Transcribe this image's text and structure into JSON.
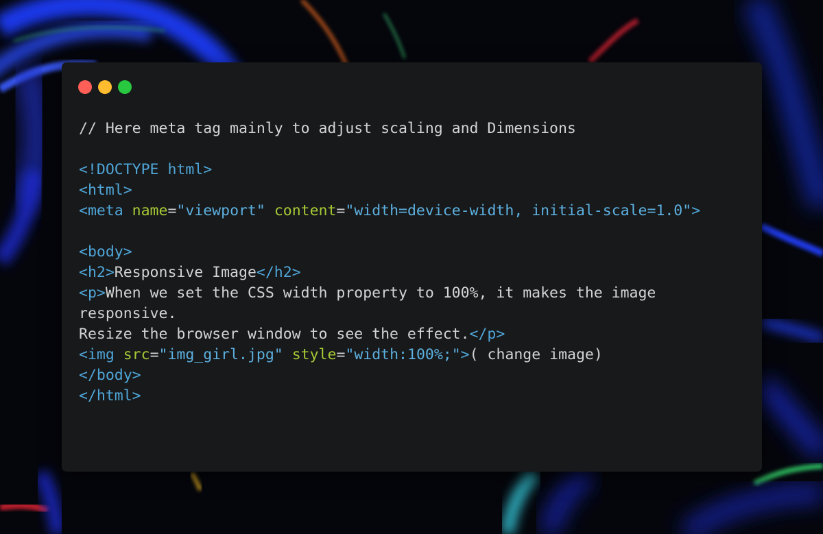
{
  "window_controls": {
    "close_color": "#ff5f57",
    "minimize_color": "#febc2e",
    "maximize_color": "#28c840"
  },
  "colors": {
    "window_bg": "#18191b",
    "tag": "#4fa6d8",
    "attribute": "#a6c936",
    "string": "#5cb0e0",
    "text": "#d4d4d4"
  },
  "code_lines": [
    [
      {
        "t": "comment",
        "v": "// Here meta tag mainly to adjust scaling and Dimensions"
      }
    ],
    [],
    [
      {
        "t": "tag",
        "v": "<!DOCTYPE html>"
      }
    ],
    [
      {
        "t": "tag",
        "v": "<html>"
      }
    ],
    [
      {
        "t": "tag",
        "v": "<meta "
      },
      {
        "t": "attr",
        "v": "name"
      },
      {
        "t": "text",
        "v": "="
      },
      {
        "t": "str",
        "v": "\"viewport\""
      },
      {
        "t": "text",
        "v": " "
      },
      {
        "t": "attr",
        "v": "content"
      },
      {
        "t": "text",
        "v": "="
      },
      {
        "t": "str",
        "v": "\"width=device-width, initial-scale=1.0\""
      },
      {
        "t": "tag",
        "v": ">"
      }
    ],
    [],
    [
      {
        "t": "tag",
        "v": "<body>"
      }
    ],
    [
      {
        "t": "tag",
        "v": "<h2>"
      },
      {
        "t": "text",
        "v": "Responsive Image"
      },
      {
        "t": "tag",
        "v": "</h2>"
      }
    ],
    [
      {
        "t": "tag",
        "v": "<p>"
      },
      {
        "t": "text",
        "v": "When we set the CSS width property to 100%, it makes the image"
      }
    ],
    [
      {
        "t": "text",
        "v": "responsive."
      }
    ],
    [
      {
        "t": "text",
        "v": "Resize the browser window to see the effect."
      },
      {
        "t": "tag",
        "v": "</p>"
      }
    ],
    [
      {
        "t": "tag",
        "v": "<img "
      },
      {
        "t": "attr",
        "v": "src"
      },
      {
        "t": "text",
        "v": "="
      },
      {
        "t": "str",
        "v": "\"img_girl.jpg\""
      },
      {
        "t": "text",
        "v": " "
      },
      {
        "t": "attr",
        "v": "style"
      },
      {
        "t": "text",
        "v": "="
      },
      {
        "t": "str",
        "v": "\"width:100%;\""
      },
      {
        "t": "tag",
        "v": ">"
      },
      {
        "t": "text",
        "v": "( change image)"
      }
    ],
    [
      {
        "t": "tag",
        "v": "</body>"
      }
    ],
    [
      {
        "t": "tag",
        "v": "</html>"
      }
    ]
  ]
}
